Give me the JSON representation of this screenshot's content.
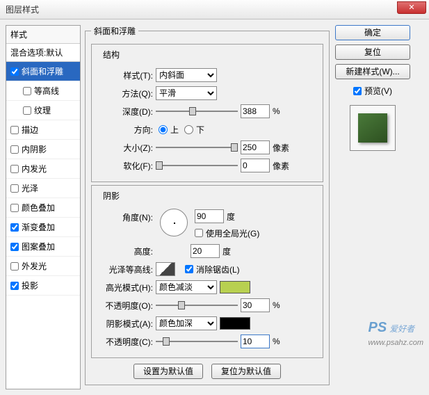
{
  "window": {
    "title": "图层样式",
    "close": "✕"
  },
  "sidebar": {
    "header": "样式",
    "blend": "混合选项:默认",
    "items": [
      {
        "label": "斜面和浮雕",
        "checked": true,
        "selected": true
      },
      {
        "label": "等高线",
        "checked": false,
        "sub": true
      },
      {
        "label": "纹理",
        "checked": false,
        "sub": true
      },
      {
        "label": "描边",
        "checked": false
      },
      {
        "label": "内阴影",
        "checked": false
      },
      {
        "label": "内发光",
        "checked": false
      },
      {
        "label": "光泽",
        "checked": false
      },
      {
        "label": "颜色叠加",
        "checked": false
      },
      {
        "label": "渐变叠加",
        "checked": true
      },
      {
        "label": "图案叠加",
        "checked": true
      },
      {
        "label": "外发光",
        "checked": false
      },
      {
        "label": "投影",
        "checked": true
      }
    ]
  },
  "main": {
    "legend": "斜面和浮雕",
    "structure": {
      "title": "结构",
      "style_label": "样式(T):",
      "style_value": "内斜面",
      "method_label": "方法(Q):",
      "method_value": "平滑",
      "depth_label": "深度(D):",
      "depth_value": "388",
      "depth_unit": "%",
      "direction_label": "方向:",
      "up": "上",
      "down": "下",
      "size_label": "大小(Z):",
      "size_value": "250",
      "size_unit": "像素",
      "soften_label": "软化(F):",
      "soften_value": "0",
      "soften_unit": "像素"
    },
    "shading": {
      "title": "阴影",
      "angle_label": "角度(N):",
      "angle_value": "90",
      "angle_unit": "度",
      "global_label": "使用全局光(G)",
      "altitude_label": "高度:",
      "altitude_value": "20",
      "altitude_unit": "度",
      "gloss_label": "光泽等高线:",
      "antialias_label": "消除锯齿(L)",
      "highlight_label": "高光模式(H):",
      "highlight_value": "颜色减淡",
      "highlight_color": "#b8d050",
      "highlight_op_label": "不透明度(O):",
      "highlight_op_value": "30",
      "highlight_op_unit": "%",
      "shadow_label": "阴影模式(A):",
      "shadow_value": "颜色加深",
      "shadow_color": "#000000",
      "shadow_op_label": "不透明度(C):",
      "shadow_op_value": "10",
      "shadow_op_unit": "%"
    },
    "default_btn": "设置为默认值",
    "reset_btn": "复位为默认值"
  },
  "right": {
    "ok": "确定",
    "cancel": "复位",
    "new_style": "新建样式(W)...",
    "preview_label": "预览(V)"
  },
  "watermark": {
    "ps": "PS",
    "text": "爱好者",
    "url": "www.psahz.com"
  }
}
